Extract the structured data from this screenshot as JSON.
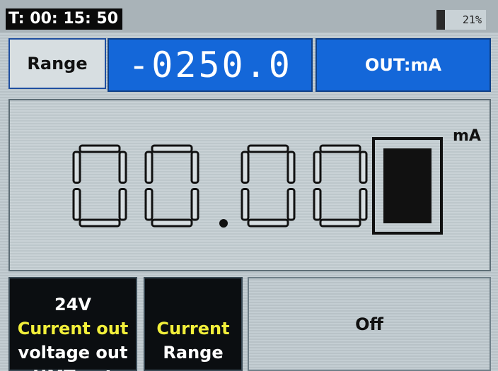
{
  "status": {
    "timer": "T: 00: 15: 50",
    "battery_percent": "21%",
    "battery_level": 0.21
  },
  "controls": {
    "range_label": "Range",
    "setpoint_value": "-0250.0",
    "output_mode": "OUT:mA"
  },
  "reading": {
    "value": "00.00",
    "unit": "mA"
  },
  "menu": {
    "power_options": [
      "24V",
      "Current out",
      "voltage out",
      "HMT out"
    ],
    "selected_power_option": "Current out",
    "function_options": [
      "Current",
      "Range"
    ],
    "selected_function_option": "Current",
    "state": "Off"
  },
  "colors": {
    "accent_blue": "#1467d9",
    "highlight_yellow": "#f2ef3a"
  }
}
